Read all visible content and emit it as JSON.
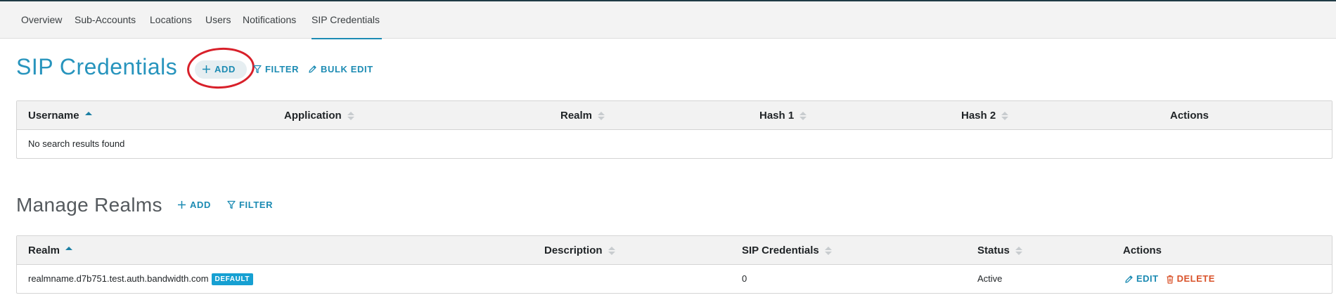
{
  "tabs": [
    {
      "label": "Overview"
    },
    {
      "label": "Sub-Accounts"
    },
    {
      "label": "Locations"
    },
    {
      "label": "Users"
    },
    {
      "label": "Notifications"
    },
    {
      "label": "SIP Credentials",
      "active": true
    }
  ],
  "sip_credentials": {
    "title": "SIP Credentials",
    "add_label": "ADD",
    "filter_label": "FILTER",
    "bulk_edit_label": "BULK EDIT",
    "columns": [
      "Username",
      "Application",
      "Realm",
      "Hash 1",
      "Hash 2",
      "Actions"
    ],
    "sorted_column": "Username",
    "empty_message": "No search results found"
  },
  "realms": {
    "title": "Manage Realms",
    "add_label": "ADD",
    "filter_label": "FILTER",
    "columns": [
      "Realm",
      "Description",
      "SIP Credentials",
      "Status",
      "Actions"
    ],
    "sorted_column": "Realm",
    "rows": [
      {
        "realm": "realmname.d7b751.test.auth.bandwidth.com",
        "badge": "DEFAULT",
        "description": "",
        "sip_credentials": "0",
        "status": "Active",
        "edit_label": "EDIT",
        "delete_label": "DELETE"
      }
    ]
  },
  "colors": {
    "accent": "#1c8bb3",
    "title_blue": "#2794bd",
    "badge": "#16a0d2",
    "delete": "#d9532b",
    "annotation": "#d8202a"
  },
  "icons": {
    "add": "plus-icon",
    "filter": "funnel-icon",
    "bulk_edit": "pencil-icon",
    "edit": "pencil-icon",
    "delete": "trash-icon"
  }
}
